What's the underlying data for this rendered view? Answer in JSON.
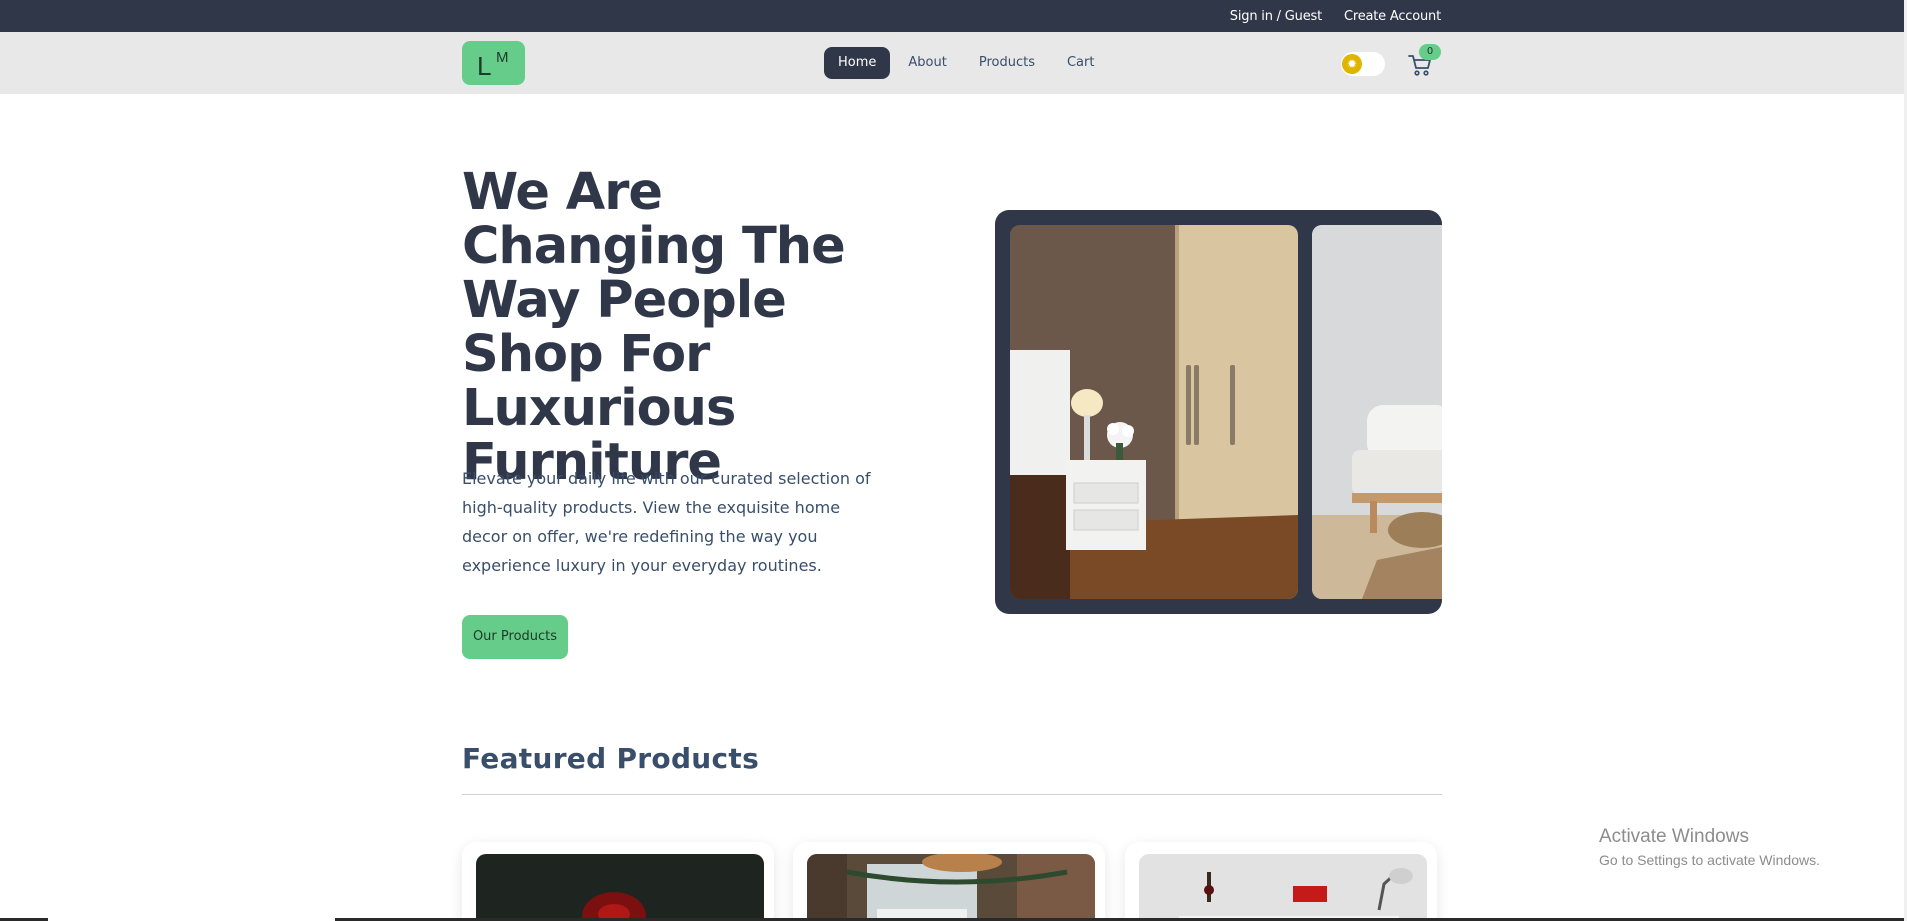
{
  "topbar": {
    "sign_in": "Sign in / Guest",
    "create_account": "Create Account"
  },
  "brand": {
    "logo_l": "L",
    "logo_m": "M"
  },
  "nav": {
    "items": [
      {
        "label": "Home",
        "active": true
      },
      {
        "label": "About",
        "active": false
      },
      {
        "label": "Products",
        "active": false
      },
      {
        "label": "Cart",
        "active": false
      }
    ]
  },
  "controls": {
    "theme_icon": "sun-icon",
    "cart_icon": "cart-icon",
    "cart_count": "0"
  },
  "hero": {
    "title": "We Are Changing The Way People Shop For Luxurious Furniture",
    "text": "Elevate your daily life with our curated selection of high-quality products. View the exquisite home decor on offer, we're redefining the way you experience luxury in your everyday routines.",
    "cta": "Our Products"
  },
  "featured": {
    "title": "Featured Products"
  },
  "watermark": {
    "line1": "Activate Windows",
    "line2": "Go to Settings to activate Windows."
  },
  "colors": {
    "dark": "#2f3748",
    "accent": "#66cc8a",
    "navbar_bg": "#e8e8e8",
    "text": "#394e6a"
  }
}
